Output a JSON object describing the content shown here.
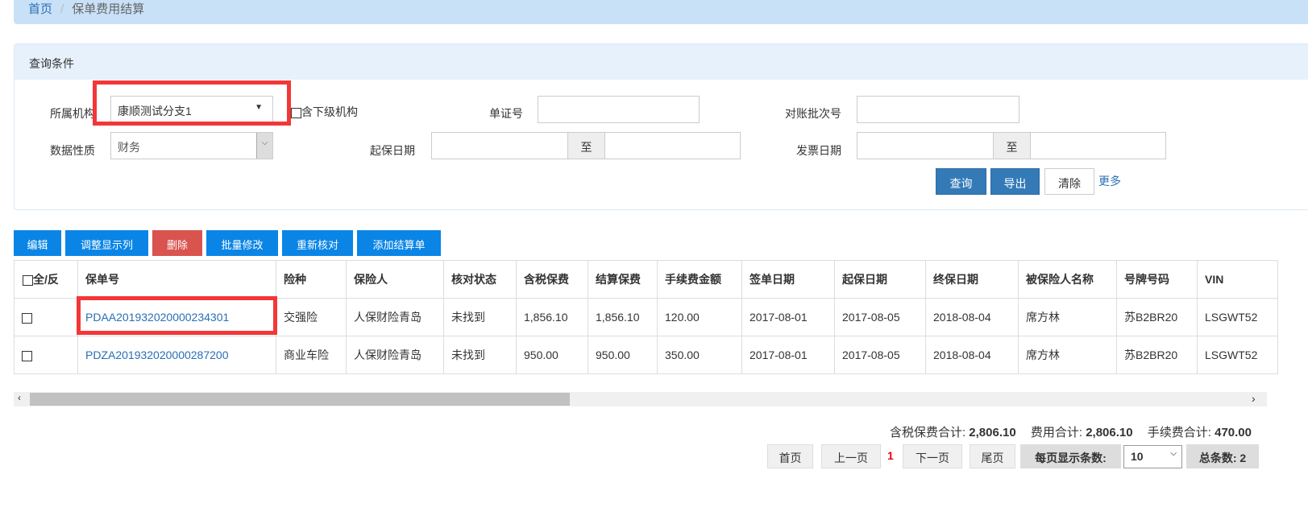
{
  "breadcrumb": {
    "home": "首页",
    "separator": "/",
    "current": "保单费用结算"
  },
  "query": {
    "title": "查询条件",
    "org_label": "所属机构",
    "org_value": "康顺测试分支1",
    "include_sub": "含下级机构",
    "cert_label": "单证号",
    "batch_label": "对账批次号",
    "nature_label": "数据性质",
    "nature_value": "财务",
    "start_label": "起保日期",
    "to": "至",
    "invoice_label": "发票日期",
    "search": "查询",
    "export": "导出",
    "clear": "清除",
    "more": "更多"
  },
  "toolbar": {
    "edit": "编辑",
    "columns": "调整显示列",
    "delete": "删除",
    "batch_edit": "批量修改",
    "recheck": "重新核对",
    "add_settlement": "添加结算单"
  },
  "table": {
    "headers": [
      "全/反",
      "保单号",
      "险种",
      "保险人",
      "核对状态",
      "含税保费",
      "结算保费",
      "手续费金额",
      "签单日期",
      "起保日期",
      "终保日期",
      "被保险人名称",
      "号牌号码",
      "VIN"
    ],
    "rows": [
      [
        "PDAA201932020000234301",
        "交强险",
        "人保财险青岛",
        "未找到",
        "1,856.10",
        "1,856.10",
        "120.00",
        "2017-08-01",
        "2017-08-05",
        "2018-08-04",
        "席方林",
        "苏B2BR20",
        "LSGWT52"
      ],
      [
        "PDZA201932020000287200",
        "商业车险",
        "人保财险青岛",
        "未找到",
        "950.00",
        "950.00",
        "350.00",
        "2017-08-01",
        "2017-08-05",
        "2018-08-04",
        "席方林",
        "苏B2BR20",
        "LSGWT52"
      ]
    ]
  },
  "totals": {
    "premium_label": "含税保费合计:",
    "premium": "2,806.10",
    "fee_label": "费用合计:",
    "fee": "2,806.10",
    "commission_label": "手续费合计:",
    "commission": "470.00"
  },
  "pager": {
    "first": "首页",
    "prev": "上一页",
    "current": "1",
    "next": "下一页",
    "last": "尾页",
    "per_page_label": "每页显示条数:",
    "per_page": "10",
    "total": "总条数: 2"
  }
}
